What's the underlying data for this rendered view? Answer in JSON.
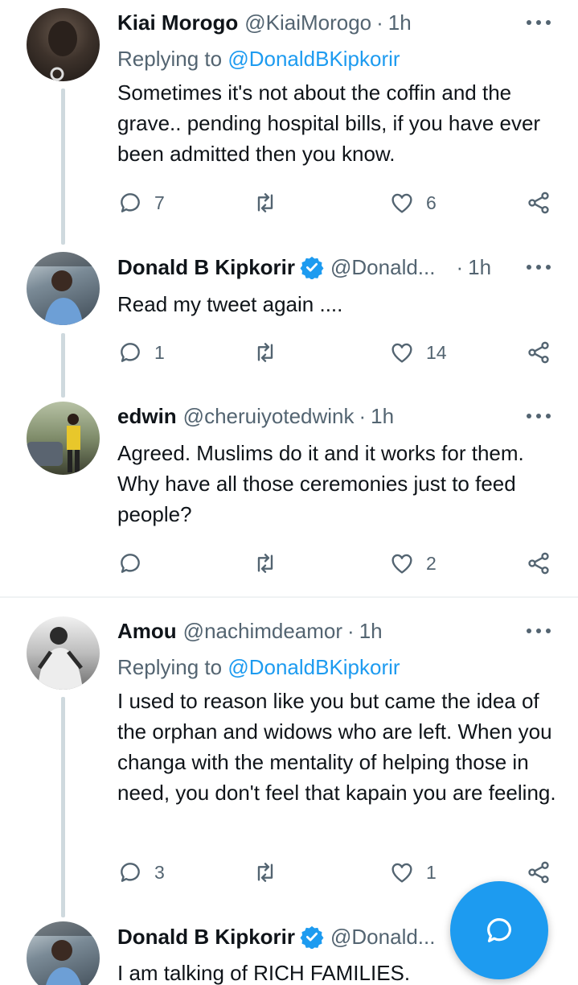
{
  "tweets": [
    {
      "name": "Kiai Morogo",
      "handle": "@KiaiMorogo",
      "time": "1h",
      "replying_prefix": "Replying to ",
      "replying_to": "@DonaldBKipkorir",
      "text": "Sometimes it's not about the coffin and the grave.. pending hospital bills, if you have ever been admitted then you know.",
      "replies": "7",
      "retweets": "",
      "likes": "6"
    },
    {
      "name": "Donald B Kipkorir",
      "verified": true,
      "handle": "@Donald...",
      "time": "1h",
      "text": "Read my tweet again ....",
      "replies": "1",
      "retweets": "",
      "likes": "14"
    },
    {
      "name": "edwin",
      "handle": "@cheruiyotedwink",
      "time": "1h",
      "text": "Agreed. Muslims do it and it works for them. Why have all those ceremonies just to feed people?",
      "replies": "",
      "retweets": "",
      "likes": "2"
    },
    {
      "name": "Amou",
      "handle": "@nachimdeamor",
      "time": "1h",
      "replying_prefix": "Replying to ",
      "replying_to": "@DonaldBKipkorir",
      "text": "I used to reason like you but came the idea of the orphan and widows who are left. When you changa with the mentality of helping those in need, you don't feel that kapain you are feeling.",
      "replies": "3",
      "retweets": "",
      "likes": "1"
    },
    {
      "name": "Donald B Kipkorir",
      "verified": true,
      "handle": "@Donald...",
      "time": "",
      "text": "I am talking of RICH FAMILIES."
    }
  ],
  "separator": "·",
  "icons": {
    "reply": "reply-icon",
    "retweet": "retweet-icon",
    "like": "heart-icon",
    "share": "share-icon",
    "more": "more-icon",
    "verified": "verified-badge-icon",
    "compose": "compose-reply-icon"
  },
  "colors": {
    "accent": "#1d9bf0",
    "secondary_text": "#536471",
    "thread_line": "#cfd9de"
  }
}
